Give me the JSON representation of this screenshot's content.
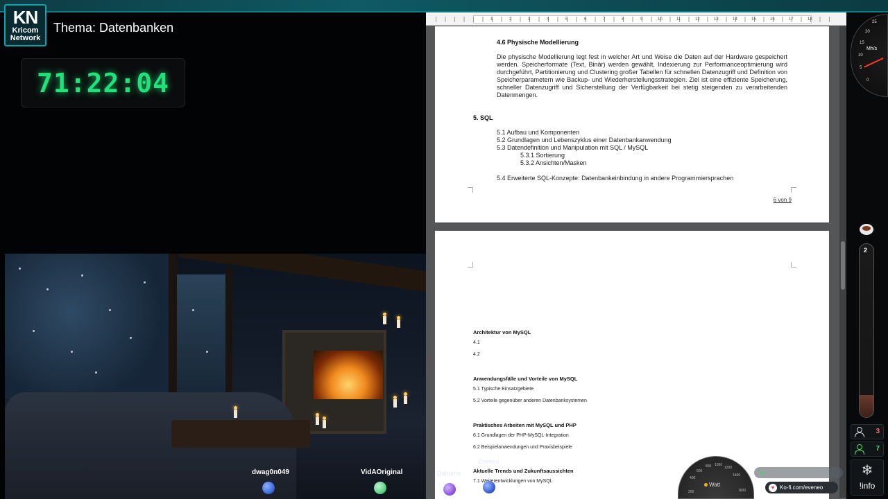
{
  "branding": {
    "logo_letters": "KN",
    "logo_line1": "Kricom",
    "logo_line2": "Network",
    "topic": "Thema: Datenbanken"
  },
  "timer": {
    "value": "71:22:04"
  },
  "viewers": [
    {
      "name": "dwag0n049",
      "orb_color": "#3f6fe0"
    },
    {
      "name": "VidAOriginal",
      "orb_color": "#5fd38a"
    }
  ],
  "overlay_names": {
    "name1": "Dahuma",
    "name2": "Eveneo"
  },
  "orbs_bottom": [
    "#8f5be0",
    "#3a63d6"
  ],
  "document": {
    "ruler_numbers": [
      "1",
      "2",
      "3",
      "4",
      "5",
      "6",
      "7",
      "8",
      "9",
      "10",
      "11",
      "12",
      "13",
      "14",
      "15",
      "16",
      "17",
      "18"
    ],
    "page1": {
      "section_heading": "4.6 Physische Modellierung",
      "paragraph": "Die physische Modellierung legt fest in welcher Art und Weise die Daten auf der Hardware gespeichert werden. Speicherformate (Text, Binär) werden gewählt, Indexierung zur Performanceoptimierung wird durchgeführt, Partitionierung und Clustering großer Tabellen für schnellen Datenzugriff und Definition von Speicherparametern wie Backup- und Wiederherstellungsstrategien. Ziel ist eine effiziente Speicherung, schneller Datenzugriff und Sicherstellung der Verfügbarkeit bei stetig steigenden zu verarbeitenden Datenmengen.",
      "chapter_heading": "5. SQL",
      "toc": [
        "5.1 Aufbau und Komponenten",
        "5.2 Grundlagen und Lebenszyklus einer Datenbankanwendung",
        "5.3 Datendefinition und Manipulation mit SQL / MySQL",
        "5.3.1 Sortierung",
        "5.3.2 Ansichten/Masken",
        "5.4 Erweiterte SQL-Konzepte: Datenbankeinbindung in andere Programmiersprachen"
      ],
      "page_number": "6 von 9"
    },
    "page2": {
      "blocks": [
        {
          "heading": "Architektur von MySQL",
          "items": [
            "4.1",
            "4.2"
          ]
        },
        {
          "heading": "Anwendungsfälle und Vorteile von MySQL",
          "items": [
            "5.1 Typische Einsatzgebiete",
            "5.2 Vorteile gegenüber anderen Datenbanksystemen"
          ]
        },
        {
          "heading": "Praktisches Arbeiten mit MySQL und PHP",
          "items": [
            "6.1 Grundlagen der PHP-MySQL-Integration",
            "6.2 Beispielanwendungen und Praxisbeispiele"
          ]
        },
        {
          "heading": "Aktuelle Trends und Zukunftsaussichten",
          "items": [
            "7.1 Weiterentwicklungen von MySQL"
          ]
        }
      ]
    }
  },
  "widgets": {
    "gauge_label": "Watt",
    "gauge_ticks": [
      "200",
      "400",
      "600",
      "800",
      "1000",
      "1200",
      "1400",
      "1600"
    ],
    "kofi_text": "Ko-fi.com/eveneo",
    "speedo_unit": "Mh/s",
    "speedo_ticks": [
      "0",
      "5",
      "10",
      "15",
      "20",
      "25"
    ],
    "thermo_value": "2",
    "stat_1": {
      "count": "3",
      "color": "#ff6b6b"
    },
    "stat_2": {
      "count": "7",
      "color": "#57e06b"
    },
    "info_label": "!info"
  }
}
